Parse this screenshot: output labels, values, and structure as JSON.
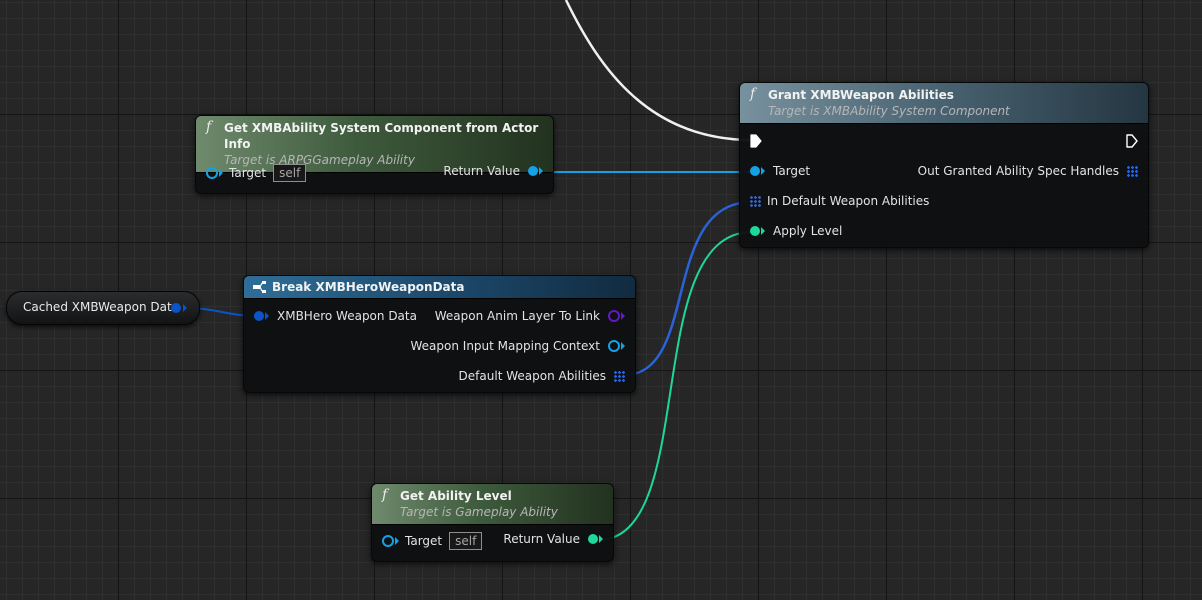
{
  "colors": {
    "object_pin": "#13a2e6",
    "struct_pin": "#0a54c8",
    "int_pin": "#1ed79a",
    "array_pin": "#2a62d8",
    "anim_layer_pin": "#6419c8",
    "exec_wire": "#f0f0f0"
  },
  "icons": {
    "function": "function-f-icon",
    "break_struct": "break-struct-icon",
    "exec_in": "exec-pin-icon",
    "exec_out": "exec-pin-icon"
  },
  "nodes": {
    "get_asc": {
      "title": "Get XMBAbility System Component from Actor Info",
      "subtitle": "Target is ARPGGameplay Ability",
      "target_label": "Target",
      "target_value": "self",
      "return_label": "Return Value"
    },
    "grant": {
      "title": "Grant XMBWeapon Abilities",
      "subtitle": "Target is XMBAbility System Component",
      "target_label": "Target",
      "out_label": "Out Granted Ability Spec Handles",
      "in_default_label": "In Default Weapon Abilities",
      "apply_level_label": "Apply Level"
    },
    "cached_var": {
      "label": "Cached XMBWeapon Data"
    },
    "break": {
      "title": "Break XMBHeroWeaponData",
      "in_label": "XMBHero Weapon Data",
      "anim_layer_label": "Weapon Anim Layer To Link",
      "input_mapping_label": "Weapon Input Mapping Context",
      "default_abilities_label": "Default Weapon Abilities"
    },
    "get_level": {
      "title": "Get Ability Level",
      "subtitle": "Target is Gameplay Ability",
      "target_label": "Target",
      "target_value": "self",
      "return_label": "Return Value"
    }
  }
}
